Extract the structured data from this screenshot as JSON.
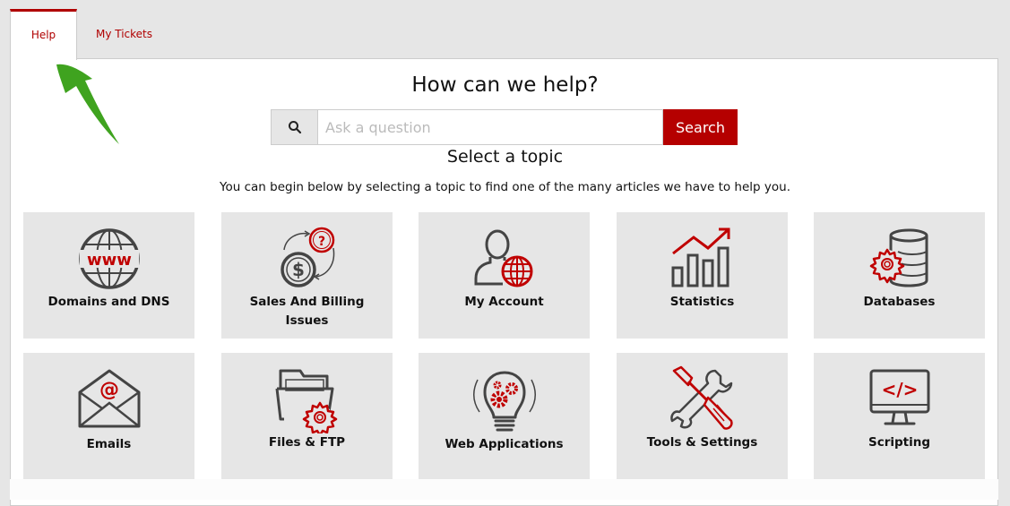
{
  "tabs": [
    {
      "label": "Help",
      "active": true
    },
    {
      "label": "My Tickets",
      "active": false
    }
  ],
  "header": {
    "title": "How can we help?"
  },
  "search": {
    "placeholder": "Ask a question",
    "value": "",
    "button_label": "Search",
    "icon": "search-icon"
  },
  "topics_section": {
    "title": "Select a topic",
    "description": "You can begin below by selecting a topic to find one of the many articles we have to help you."
  },
  "topics": [
    {
      "label": "Domains and DNS",
      "icon": "globe-www-icon"
    },
    {
      "label": "Sales And Billing Issues",
      "icon": "billing-icon"
    },
    {
      "label": "My Account",
      "icon": "user-globe-icon"
    },
    {
      "label": "Statistics",
      "icon": "bar-chart-icon"
    },
    {
      "label": "Databases",
      "icon": "database-gear-icon"
    },
    {
      "label": "Emails",
      "icon": "envelope-at-icon"
    },
    {
      "label": "Files & FTP",
      "icon": "folder-gear-icon"
    },
    {
      "label": "Web Applications",
      "icon": "lightbulb-gears-icon"
    },
    {
      "label": "Tools & Settings",
      "icon": "tools-icon"
    },
    {
      "label": "Scripting",
      "icon": "monitor-code-icon"
    }
  ],
  "colors": {
    "accent": "#b50000",
    "icon_dark": "#444444",
    "card_bg": "#e6e6e6",
    "annotation_arrow": "#3fa31f"
  }
}
